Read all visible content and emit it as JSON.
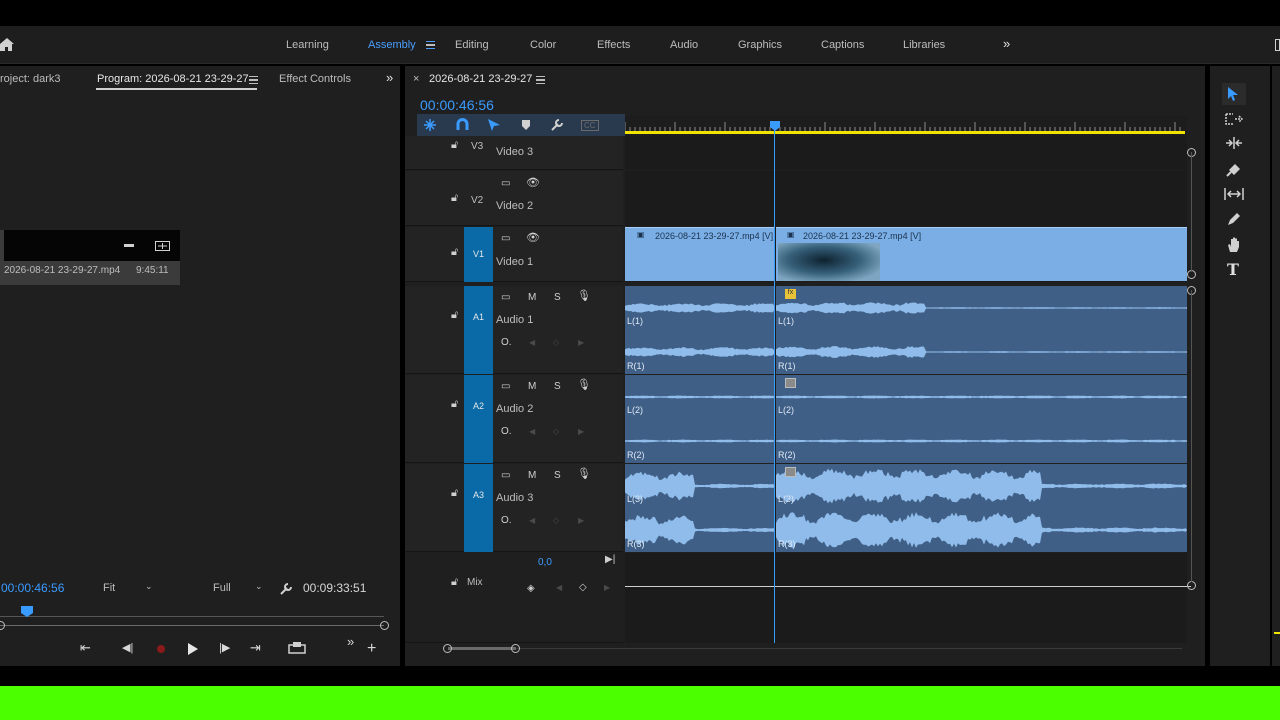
{
  "workspaces": {
    "items": [
      "Learning",
      "Assembly",
      "Editing",
      "Color",
      "Effects",
      "Audio",
      "Graphics",
      "Captions",
      "Libraries"
    ],
    "active": "Assembly"
  },
  "left_panel": {
    "tabs": [
      "roject: dark3",
      "Program: 2026-08-21 23-29-27",
      "Effect Controls"
    ],
    "thumb_filename": "2026-08-21 23-29-27.mp4",
    "thumb_duration": "9:45:11",
    "timecode": "00:00:46:56",
    "fit_label": "Fit",
    "full_label": "Full",
    "duration": "00:09:33:51"
  },
  "timeline": {
    "tab_title": "2026-08-21 23-29-27",
    "timecode": "00:00:46:56",
    "tracks": {
      "v3": {
        "badge": "V3",
        "name": "Video 3"
      },
      "v2": {
        "badge": "V2",
        "name": "Video 2"
      },
      "v1": {
        "badge": "V1",
        "name": "Video 1"
      },
      "a1": {
        "badge": "A1",
        "name": "Audio 1"
      },
      "a2": {
        "badge": "A2",
        "name": "Audio 2"
      },
      "a3": {
        "badge": "A3",
        "name": "Audio 3"
      },
      "mix": {
        "name": "Mix",
        "value": "0,0"
      }
    },
    "clips": {
      "v1_clip1": "2026-08-21 23-29-27.mp4 [V]",
      "v1_clip2": "2026-08-21 23-29-27.mp4 [V]"
    },
    "channel_labels": {
      "a1_l": "L(1)",
      "a1_r": "R(1)",
      "a2_l": "L(2)",
      "a2_r": "R(2)",
      "a3_l": "L(3)",
      "a3_r": "R(3)"
    },
    "mute_label": "M",
    "solo_label": "S"
  },
  "colors": {
    "accent": "#3a9bff",
    "video_clip": "#7aaee4",
    "audio_clip": "#3f5f86",
    "track_badge": "#0a6aa7",
    "work_area": "#f1e400",
    "green_bar": "#4cff00"
  },
  "icons": {
    "home": "home-icon",
    "lock": "lock-icon",
    "eye": "eye-icon",
    "mic": "microphone-icon",
    "tools": [
      "selection-tool-icon",
      "track-select-forward-icon",
      "ripple-edit-icon",
      "razor-icon",
      "slip-icon",
      "pen-icon",
      "hand-icon",
      "type-icon"
    ]
  }
}
